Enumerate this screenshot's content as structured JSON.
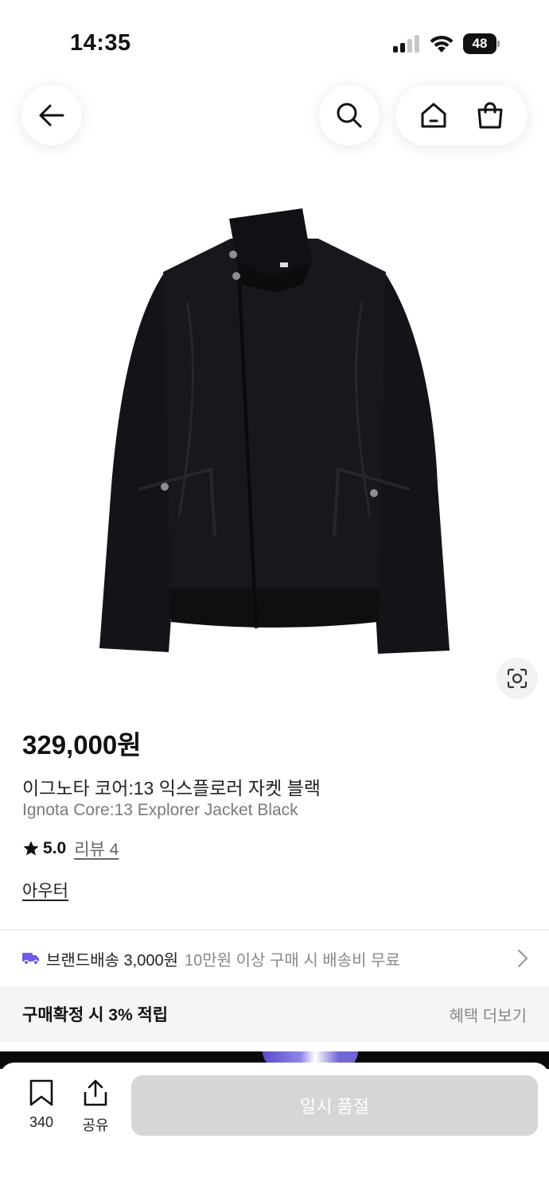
{
  "status_bar": {
    "time": "14:35",
    "battery": "48"
  },
  "nav": {
    "back_icon": "arrow-left-icon",
    "search_icon": "search-icon",
    "home_icon": "home-icon",
    "cart_icon": "shopping-bag-icon"
  },
  "product": {
    "image": "black-jacket-photo",
    "price": "329,000원",
    "name_ko": "이그노타 코어:13 익스플로러 자켓 블랙",
    "name_en": "Ignota Core:13 Explorer Jacket Black",
    "rating": "5.0",
    "review_link": "리뷰 4",
    "category": "아우터"
  },
  "shipping": {
    "label": "브랜드배송 3,000원",
    "note": "10만원 이상 구매 시 배송비 무료",
    "accent_color": "#6e5ce6"
  },
  "reward": {
    "text": "구매확정 시 3% 적립",
    "more": "혜택 더보기"
  },
  "bottom_bar": {
    "bookmark_count": "340",
    "share_label": "공유",
    "cta_label": "일시 품절",
    "cta_color": "#d6d6d6"
  }
}
